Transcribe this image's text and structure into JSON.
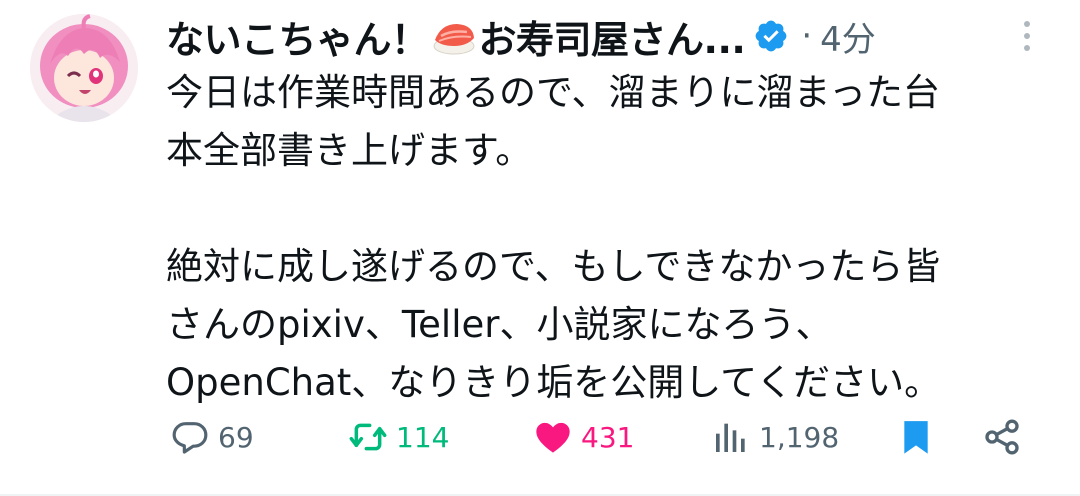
{
  "tweet": {
    "display_name": "ないこちゃん！",
    "display_name_suffix": "お寿司屋さん...",
    "name_emoji": "sushi-emoji",
    "verified_icon": "verified-badge-icon",
    "separator": "·",
    "time_ago": "4分",
    "text_lines": [
      "今日は作業時間あるので、溜まりに溜まった台",
      "本全部書き上げます。",
      "",
      "絶対に成し遂げるので、もしできなかったら皆",
      "さんのpixiv、Teller、小説家になろう、",
      "OpenChat、なりきり垢を公開してください。"
    ]
  },
  "actions": {
    "replies": "69",
    "retweets": "114",
    "likes": "431",
    "views": "1,198"
  },
  "colors": {
    "accent": "#1d9bf0",
    "retweet": "#00ba7c",
    "like": "#f91880",
    "secondary": "#536471"
  }
}
